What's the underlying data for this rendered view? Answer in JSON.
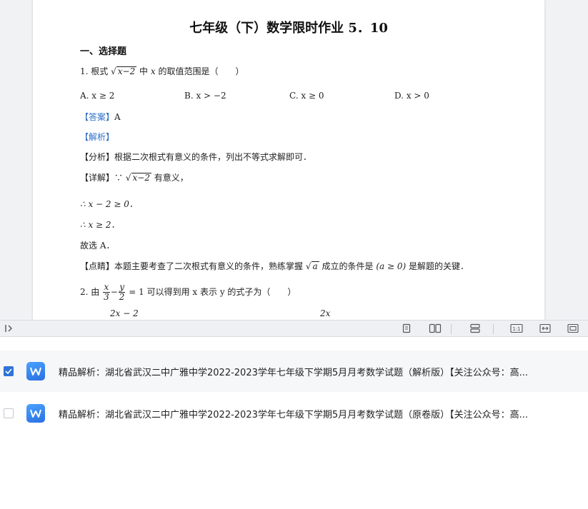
{
  "document": {
    "title": "七年级（下）数学限时作业 5．10",
    "section": "一、选择题",
    "q1": {
      "prefix": "1. 根式",
      "radicand": "x−2",
      "mid": "中",
      "var": "x",
      "suffix": "的取值范围是（　　）",
      "options": [
        "A.  x ≥ 2",
        "B.  x > −2",
        "C.  x ≥ 0",
        "D.  x > 0"
      ],
      "answer_label": "【答案】",
      "answer_value": "A",
      "analysis_label": "【解析】",
      "fenxi": "【分析】根据二次根式有意义的条件，列出不等式求解即可．",
      "detail_prefix": "【详解】∵",
      "detail_radicand": "x−2",
      "detail_suffix": "有意义，",
      "step1": "∴ x − 2 ≥ 0．",
      "step2": "∴ x ≥ 2．",
      "choose": "故选 A．",
      "comment_prefix": "【点睛】本题主要考查了二次根式有意义的条件，熟练掌握",
      "comment_radicand": "a",
      "comment_mid": "成立的条件是",
      "comment_cond": "(a ≥ 0)",
      "comment_suffix": "是解题的关键．"
    },
    "q2": {
      "prefix": "2.  由",
      "f1_num": "x",
      "f1_den": "3",
      "minus": "−",
      "f2_num": "y",
      "f2_den": "2",
      "equals": "= 1",
      "suffix": "可以得到用 x 表示 y 的式子为（　　）",
      "partial_a": "2x − 2",
      "partial_b": "2x"
    }
  },
  "toolbar": {
    "collapse_icon": "collapse-panel-icon",
    "icons": [
      "single-page-icon",
      "two-page-icon",
      "scroll-page-icon",
      "actual-size-icon",
      "fit-width-icon",
      "fit-page-icon"
    ],
    "actual_size_label": "1:1"
  },
  "files": [
    {
      "name": "精品解析：湖北省武汉二中广雅中学2022-2023学年七年级下学期5月月考数学试题（解析版）【关注公众号：高...",
      "checked": true,
      "icon": "word-doc-icon"
    },
    {
      "name": "精品解析：湖北省武汉二中广雅中学2022-2023学年七年级下学期5月月考数学试题（原卷版）【关注公众号：高...",
      "checked": false,
      "icon": "word-doc-icon"
    }
  ],
  "colors": {
    "accent": "#2f74d8",
    "answer_blue": "#2f6fc7",
    "word_icon": "#3b8cf5"
  }
}
